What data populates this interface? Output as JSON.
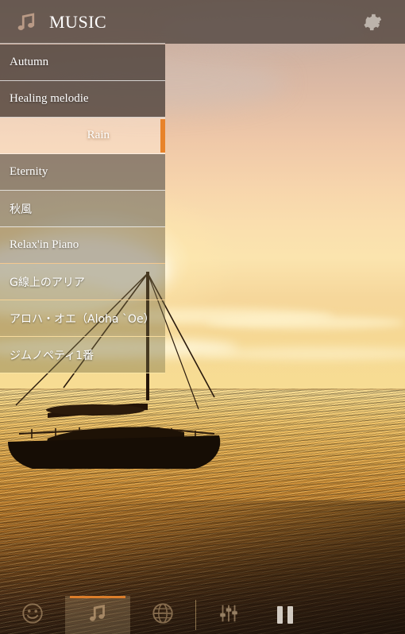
{
  "app": {
    "title": "MUSIC",
    "accent_color": "#e8832a",
    "header_bg": "#4e423c",
    "text_color": "#ffffff"
  },
  "header": {
    "logo_icon": "music-note-icon",
    "title": "MUSIC",
    "settings_icon": "gear-icon"
  },
  "tracklist": {
    "selected_index": 2,
    "items": [
      {
        "label": "Autumn",
        "script": "latin"
      },
      {
        "label": "Healing melodie",
        "script": "latin"
      },
      {
        "label": "Rain",
        "script": "latin"
      },
      {
        "label": "Eternity",
        "script": "latin"
      },
      {
        "label": "秋風",
        "script": "jp"
      },
      {
        "label": "Relax'in Piano",
        "script": "latin"
      },
      {
        "label": "G線上のアリア",
        "script": "jp"
      },
      {
        "label": "アロハ・オエ（Aloha `Oe）",
        "script": "jp"
      },
      {
        "label": "ジムノペティ1番",
        "script": "jp"
      }
    ]
  },
  "tabbar": {
    "active_index": 1,
    "tabs": [
      {
        "icon": "face-smiley-icon",
        "name": "mood-tab"
      },
      {
        "icon": "music-note-icon",
        "name": "music-tab"
      },
      {
        "icon": "globe-icon",
        "name": "world-tab"
      },
      {
        "icon": "equalizer-icon",
        "name": "equalizer-tab"
      }
    ],
    "transport": {
      "icon": "pause-icon",
      "name": "pause-button",
      "state": "playing"
    }
  },
  "background": {
    "scene": "sunset-sea-sailboat-photo"
  }
}
